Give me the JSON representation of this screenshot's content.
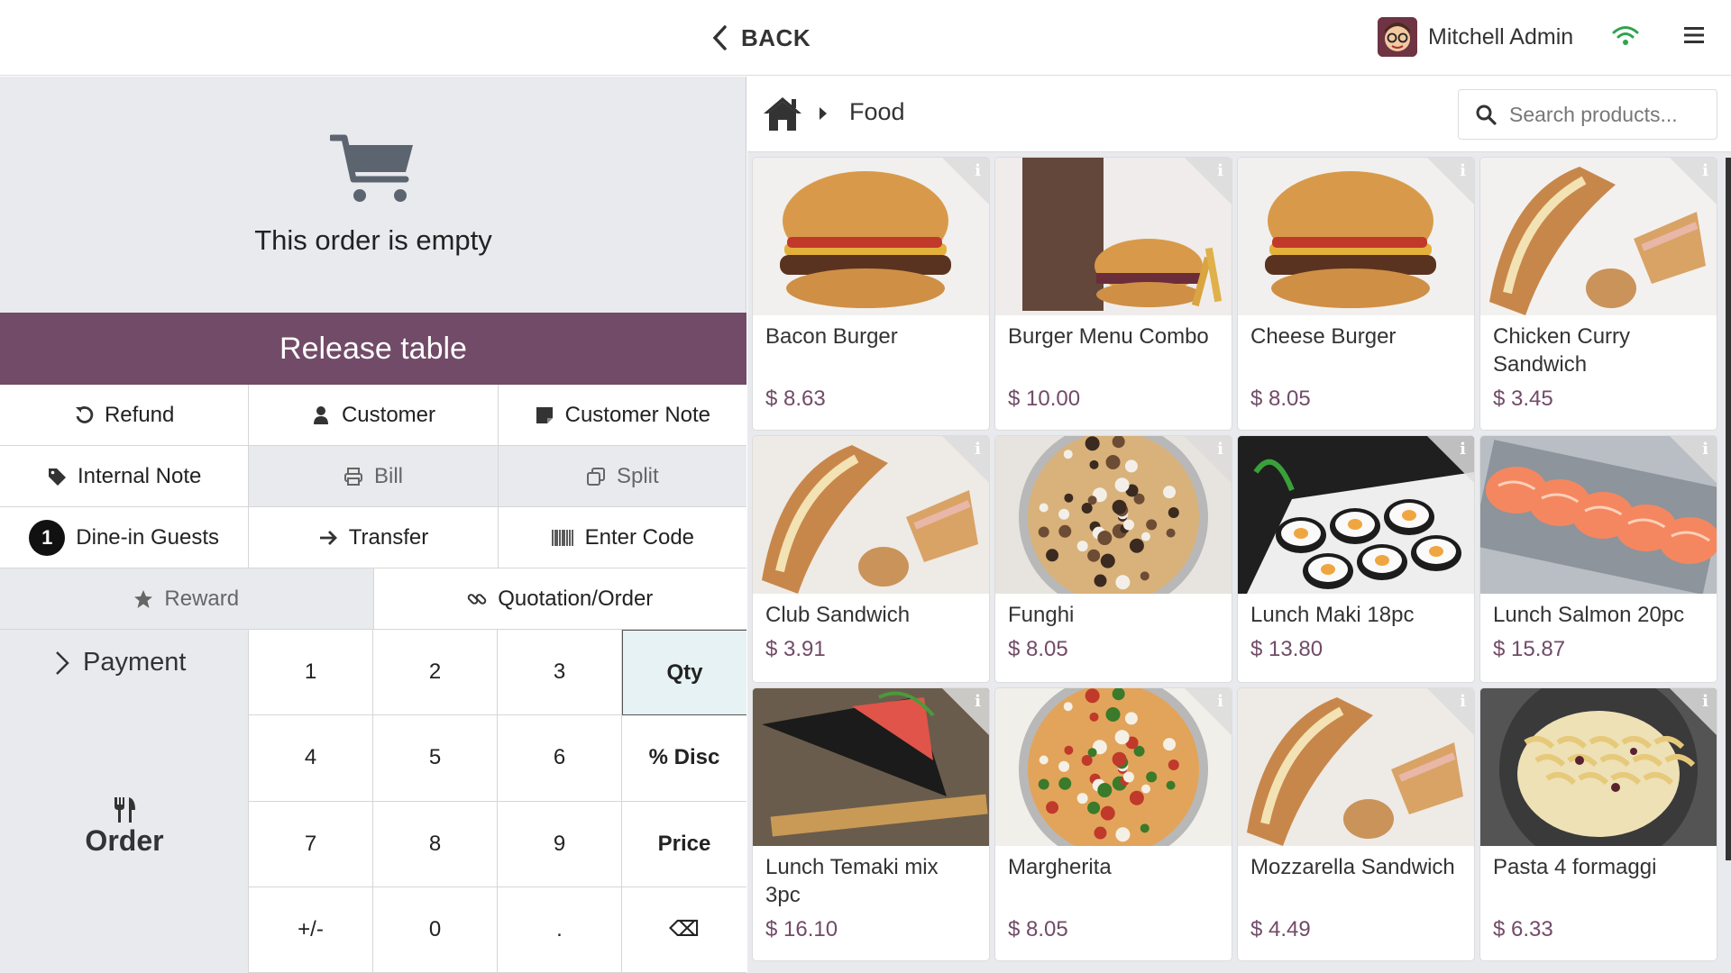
{
  "topbar": {
    "back_label": "BACK",
    "user_name": "Mitchell Admin",
    "wifi_color": "#2ea44f"
  },
  "order": {
    "empty_text": "This order is empty",
    "release_label": "Release table",
    "accent_color": "#714b67"
  },
  "controls": {
    "refund": "Refund",
    "customer": "Customer",
    "customer_note": "Customer Note",
    "internal_note": "Internal Note",
    "bill": "Bill",
    "split": "Split",
    "guests_count": "1",
    "dine_in_guests": "Dine-in Guests",
    "transfer": "Transfer",
    "enter_code": "Enter Code",
    "reward": "Reward",
    "quotation": "Quotation/Order"
  },
  "paypad": {
    "payment": "Payment",
    "order": "Order",
    "keys": [
      "1",
      "2",
      "3",
      "Qty",
      "4",
      "5",
      "6",
      "% Disc",
      "7",
      "8",
      "9",
      "Price",
      "+/-",
      "0",
      ".",
      "⌫"
    ],
    "active_mode": "Qty"
  },
  "products_header": {
    "category": "Food",
    "search_placeholder": "Search products..."
  },
  "products": [
    {
      "name": "Bacon Burger",
      "price": "$ 8.63",
      "image": "burger"
    },
    {
      "name": "Burger Menu Combo",
      "price": "$ 10.00",
      "image": "combo"
    },
    {
      "name": "Cheese Burger",
      "price": "$ 8.05",
      "image": "burger"
    },
    {
      "name": "Chicken Curry Sandwich",
      "price": "$ 3.45",
      "image": "sandwich"
    },
    {
      "name": "Club Sandwich",
      "price": "$ 3.91",
      "image": "sandwich-light"
    },
    {
      "name": "Funghi",
      "price": "$ 8.05",
      "image": "pizza-dark"
    },
    {
      "name": "Lunch Maki 18pc",
      "price": "$ 13.80",
      "image": "maki"
    },
    {
      "name": "Lunch Salmon 20pc",
      "price": "$ 15.87",
      "image": "salmon"
    },
    {
      "name": "Lunch Temaki mix 3pc",
      "price": "$ 16.10",
      "image": "temaki"
    },
    {
      "name": "Margherita",
      "price": "$ 8.05",
      "image": "pizza"
    },
    {
      "name": "Mozzarella Sandwich",
      "price": "$ 4.49",
      "image": "sandwich-light"
    },
    {
      "name": "Pasta 4 formaggi",
      "price": "$ 6.33",
      "image": "pasta"
    }
  ]
}
